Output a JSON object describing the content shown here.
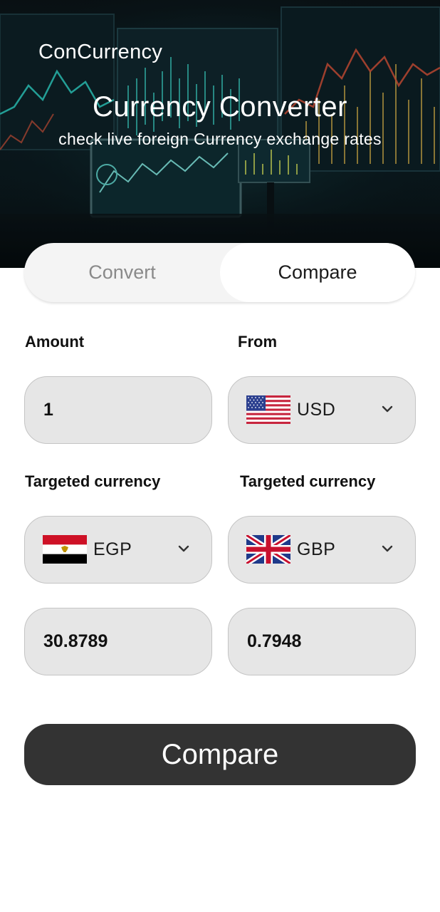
{
  "header": {
    "app_name": "ConCurrency",
    "title": "Currency Converter",
    "subtitle": "check live foreign Currency exchange rates"
  },
  "tabs": [
    {
      "label": "Convert",
      "active": false
    },
    {
      "label": "Compare",
      "active": true
    }
  ],
  "form": {
    "amount_label": "Amount",
    "from_label": "From",
    "amount_value": "1",
    "from_currency": {
      "code": "USD",
      "flag": "us-flag-icon"
    },
    "target1_label": "Targeted currency",
    "target2_label": "Targeted currency",
    "target1_currency": {
      "code": "EGP",
      "flag": "egypt-flag-icon"
    },
    "target2_currency": {
      "code": "GBP",
      "flag": "uk-flag-icon"
    },
    "result1": "30.8789",
    "result2": "0.7948"
  },
  "compare_button_label": "Compare",
  "colors": {
    "button_bg": "#333333",
    "field_bg": "#e6e6e6",
    "tab_track_bg": "#f4f4f4",
    "hero_dark": "#0b1418",
    "chart_cyan": "#2fd3c6"
  }
}
